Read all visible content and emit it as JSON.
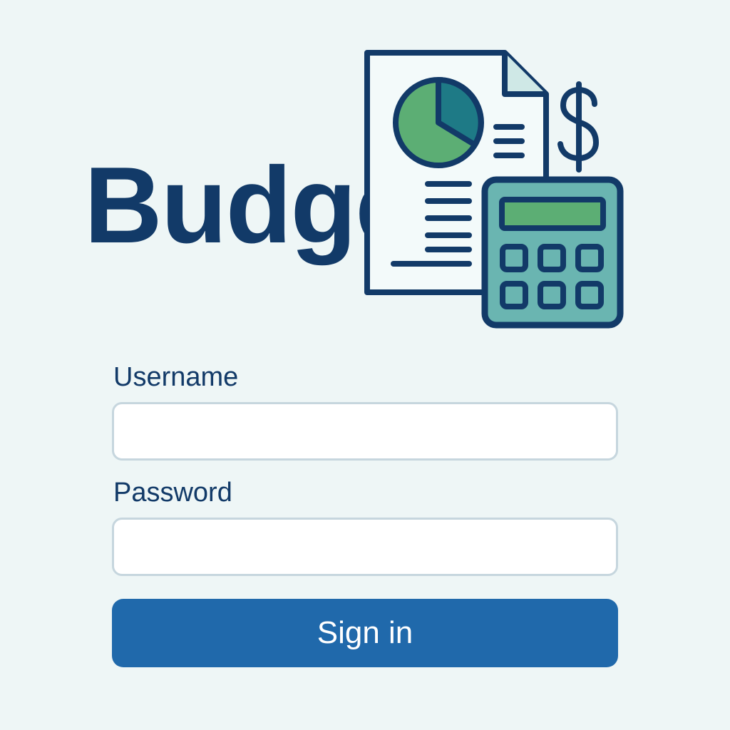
{
  "brand": {
    "title": "Budget",
    "logo_icons": [
      "report-document-icon",
      "pie-chart-icon",
      "dollar-sign-icon",
      "calculator-icon"
    ],
    "colors": {
      "navy": "#123a68",
      "teal": "#1e7a86",
      "green": "#5cae74",
      "calculator_body": "#6ab5b1",
      "background": "#eef6f6"
    }
  },
  "login_form": {
    "username_label": "Username",
    "username_value": "",
    "password_label": "Password",
    "password_value": "",
    "submit_label": "Sign in",
    "submit_color": "#2069ab"
  }
}
